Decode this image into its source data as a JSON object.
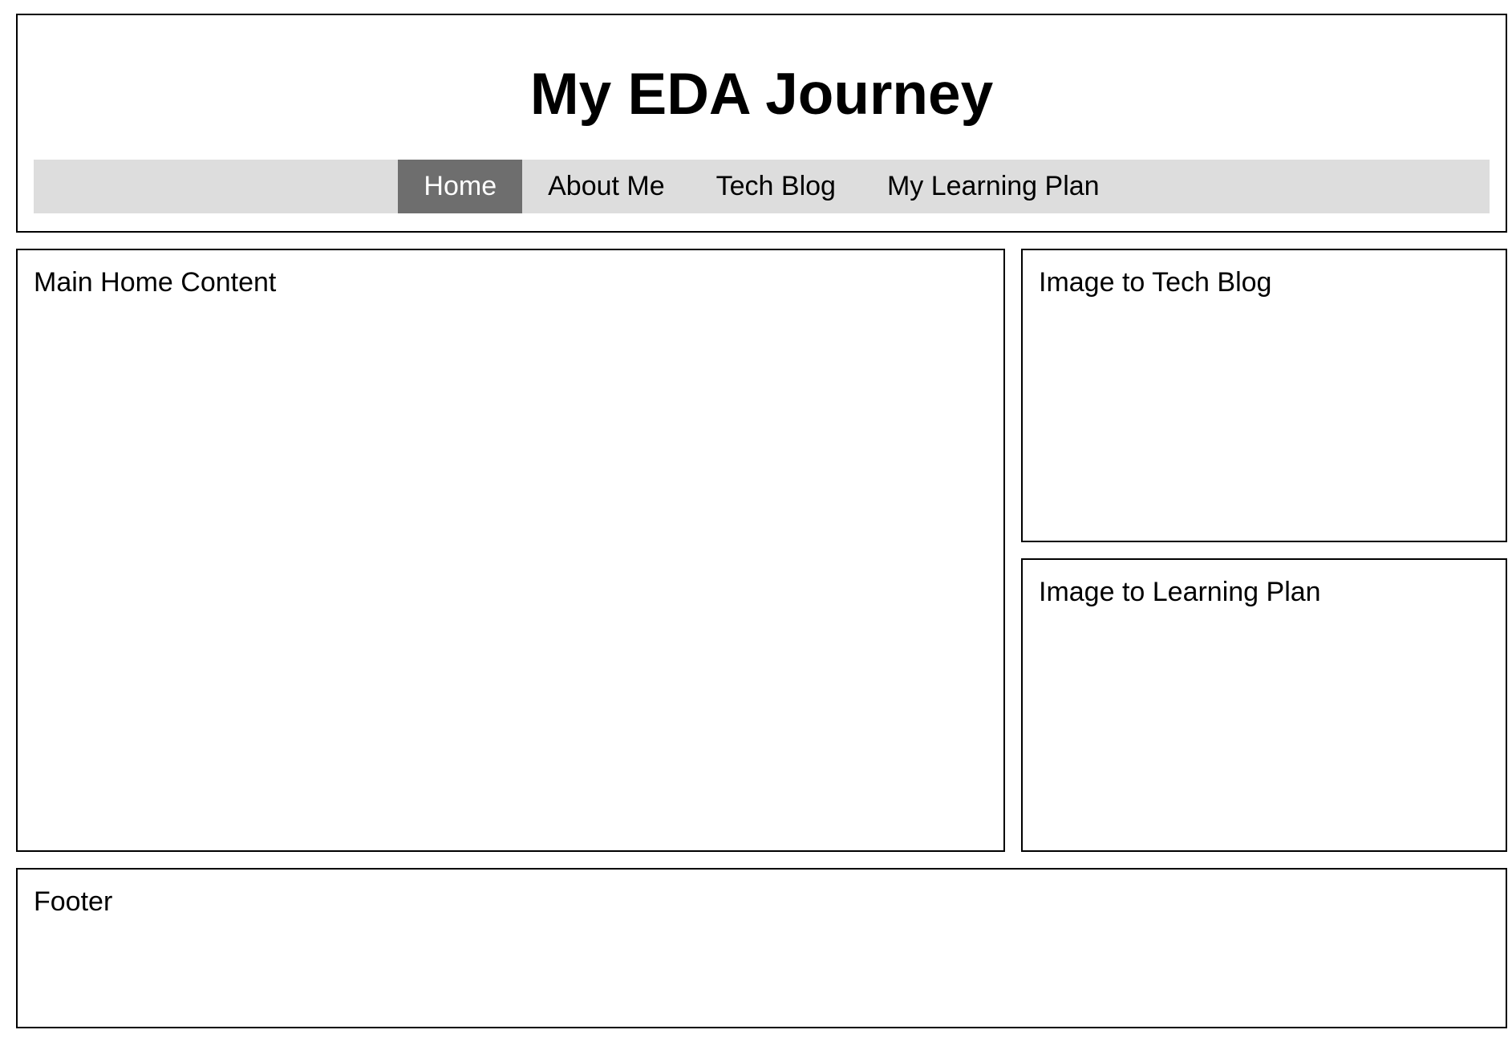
{
  "header": {
    "title": "My EDA Journey",
    "nav": [
      {
        "label": "Home",
        "active": true
      },
      {
        "label": "About Me",
        "active": false
      },
      {
        "label": "Tech Blog",
        "active": false
      },
      {
        "label": "My Learning Plan",
        "active": false
      }
    ]
  },
  "main": {
    "label": "Main Home Content"
  },
  "sidebar": {
    "tech_blog_label": "Image to Tech Blog",
    "learning_plan_label": "Image to Learning Plan"
  },
  "footer": {
    "label": "Footer"
  },
  "colors": {
    "nav_background": "#dddddd",
    "nav_active_background": "#6e6e6e",
    "nav_active_text": "#ffffff",
    "border": "#000000"
  }
}
